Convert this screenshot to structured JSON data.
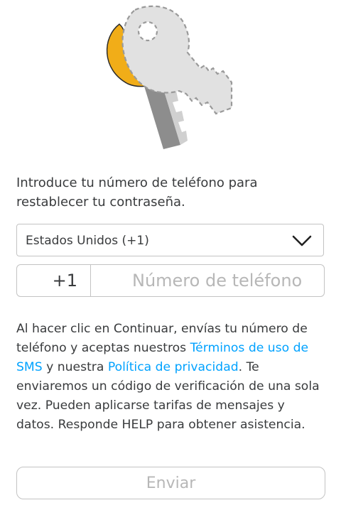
{
  "illustration": {
    "icon": "keys-icon",
    "colors": {
      "gold": "#f1ad18",
      "dark_gray": "#8d8d8d",
      "light_gray": "#cfcfcf",
      "placeholder_key": "#e1e1e1"
    }
  },
  "instruction": "Introduce tu número de teléfono para restablecer tu contraseña.",
  "country_select": {
    "value": "Estados Unidos (+1)",
    "icon": "chevron-down-icon"
  },
  "phone": {
    "dial_code": "+1",
    "placeholder": "Número de teléfono"
  },
  "legal": {
    "part1": "Al hacer clic en Continuar, envías tu número de teléfono y aceptas nuestros ",
    "terms_link": "Términos de uso de SMS",
    "part2": " y nuestra ",
    "privacy_link": "Política de privacidad",
    "part3": ". Te enviaremos un código de verificación de una sola vez. Pueden aplicarse tarifas de mensajes y datos. Responde HELP para obtener asistencia."
  },
  "send_button": {
    "label": "Enviar",
    "state": "disabled"
  },
  "colors": {
    "text": "#393b3d",
    "link": "#00a2ff",
    "border": "#c3c3c3",
    "disabled_text": "#b7b7b7"
  }
}
